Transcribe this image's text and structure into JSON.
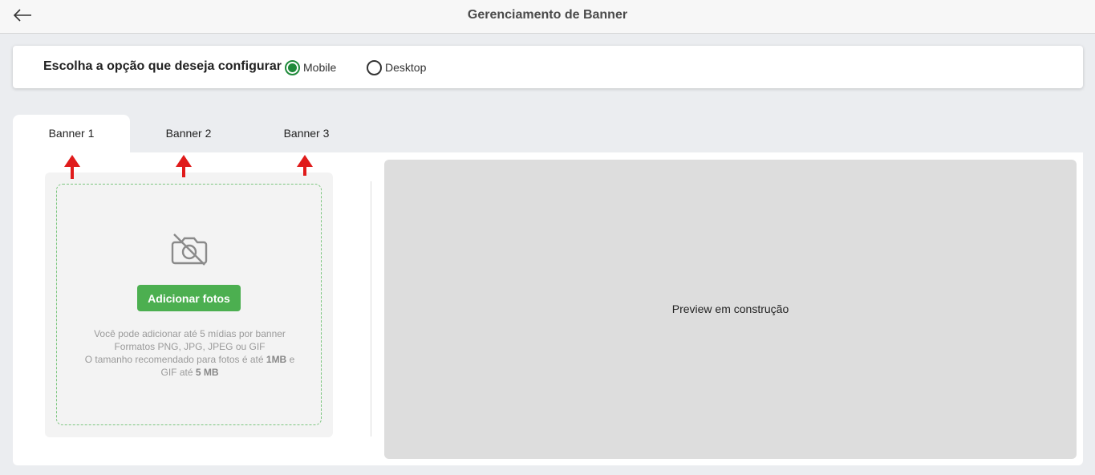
{
  "header": {
    "title": "Gerenciamento de Banner",
    "back_icon": "arrow-left-icon"
  },
  "options": {
    "label": "Escolha a opção que deseja configurar",
    "radios": [
      {
        "label": "Mobile",
        "checked": true
      },
      {
        "label": "Desktop",
        "checked": false
      }
    ],
    "accent_color": "#1f8a3a"
  },
  "tabs": [
    {
      "label": "Banner 1",
      "active": true
    },
    {
      "label": "Banner 2",
      "active": false
    },
    {
      "label": "Banner 3",
      "active": false
    }
  ],
  "upload": {
    "icon": "camera-off-icon",
    "button_label": "Adicionar fotos",
    "button_color": "#4caf50",
    "info_line1": "Você pode adicionar até 5 mídias por banner",
    "info_line2": "Formatos PNG, JPG, JPEG ou GIF",
    "info_line3_a": "O tamanho recomendado para fotos é até ",
    "info_line3_b": "1MB",
    "info_line3_c": " e",
    "info_line4_a": "GIF até ",
    "info_line4_b": "5 MB"
  },
  "preview": {
    "text": "Preview em construção"
  },
  "annotation": {
    "arrow_color": "#e01b1b"
  }
}
